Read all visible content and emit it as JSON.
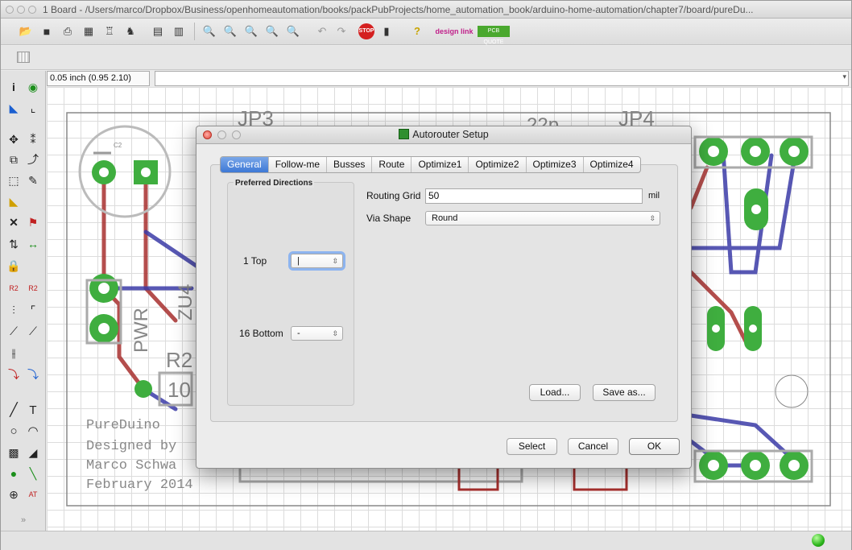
{
  "window": {
    "title": "1 Board - /Users/marco/Dropbox/Business/openhomeautomation/books/packPubProjects/home_automation_book/arduino-home-automation/chapter7/board/pureDu..."
  },
  "toolbar": {
    "icons": [
      "open-icon",
      "save-icon",
      "print-icon",
      "cam-icon",
      "ulp-icon",
      "script-icon",
      "run-icon",
      "zoom-fit-icon",
      "zoom-in-icon",
      "zoom-out-icon",
      "zoom-select-icon",
      "redraw-icon",
      "undo-icon",
      "redo-icon",
      "stop-icon",
      "go-icon",
      "help-icon",
      "designlink-icon",
      "pcb-quote-icon"
    ],
    "designlink_label": "design link",
    "pcbquote_label": "PCB QUOTE"
  },
  "command_bar": {
    "coordinates": "0.05 inch (0.95 2.10)",
    "command_value": ""
  },
  "board": {
    "silkscreen": {
      "jp3": "JP3",
      "jp4": "JP4",
      "cap_value": "22p",
      "c2": "C2",
      "r2": "R2",
      "r2_value": "10",
      "pwr": "PWR",
      "z": "ZU4",
      "text_line1": "PureDuino",
      "text_line2": "Designed by",
      "text_line3": "Marco Schwa",
      "text_line4": "February 2014"
    },
    "colors": {
      "top_copper": "#a8302e",
      "bottom_copper": "#3b3ba8",
      "pads": "#3fae3f",
      "outline": "#888888"
    }
  },
  "dialog": {
    "title": "Autorouter Setup",
    "tabs": [
      "General",
      "Follow-me",
      "Busses",
      "Route",
      "Optimize1",
      "Optimize2",
      "Optimize3",
      "Optimize4"
    ],
    "active_tab": "General",
    "preferred_directions": {
      "title": "Preferred Directions",
      "layers": [
        {
          "label": "1  Top",
          "value": "|"
        },
        {
          "label": "16  Bottom",
          "value": "-"
        }
      ]
    },
    "routing_grid": {
      "label": "Routing Grid",
      "value": "50",
      "unit": "mil"
    },
    "via_shape": {
      "label": "Via Shape",
      "value": "Round"
    },
    "buttons": {
      "load": "Load...",
      "save_as": "Save as...",
      "select": "Select",
      "cancel": "Cancel",
      "ok": "OK"
    }
  },
  "status": {
    "indicator_color": "#2bb51b"
  }
}
